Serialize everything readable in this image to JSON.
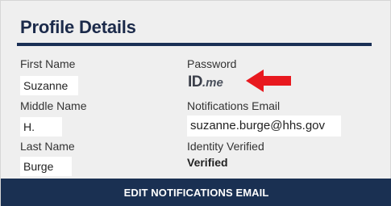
{
  "profile": {
    "title": "Profile Details",
    "fields": {
      "first_name": {
        "label": "First Name",
        "value": "Suzanne"
      },
      "middle_name": {
        "label": "Middle Name",
        "value": "H."
      },
      "last_name": {
        "label": "Last Name",
        "value": "Burge"
      },
      "password": {
        "label": "Password",
        "logo_text": "ID.me",
        "logo_id": "ID",
        "logo_me": ".me"
      },
      "notifications_email": {
        "label": "Notifications Email",
        "value": "suzanne.burge@hhs.gov"
      },
      "identity_verified": {
        "label": "Identity Verified",
        "value": "Verified"
      }
    },
    "edit_button_label": "EDIT NOTIFICATIONS EMAIL"
  },
  "colors": {
    "accent": "#1a3052",
    "arrow": "#e8191f",
    "card_background": "#efefef"
  },
  "icons": {
    "annotation_arrow": "red-left-arrow-icon"
  }
}
